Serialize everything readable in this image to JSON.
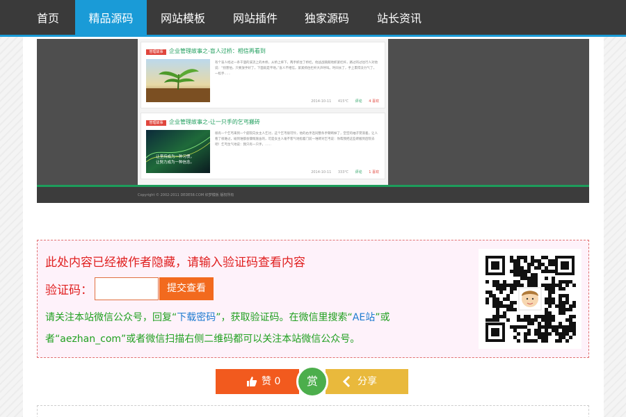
{
  "nav": {
    "items": [
      {
        "label": "首页"
      },
      {
        "label": "精品源码",
        "active": true
      },
      {
        "label": "网站模板"
      },
      {
        "label": "网站插件"
      },
      {
        "label": "独家源码"
      },
      {
        "label": "站长资讯"
      }
    ]
  },
  "screenshot": {
    "articles": [
      {
        "badge": "管理故事",
        "title": "企业管理故事之-盲人过桥：相信再看到",
        "excerpt": "有个盲人经过一条干涸的溪流上的木桥，从桥上摔下，两手抓住了桥栏。他战战兢兢地抓紧栏杆，路过的过往行人对他说：“别害怕，只要放手好了，下面就是平地。”盲人不相信，紧紧抓住栏杆大声呼叫。时间长了，手上累得没力气了，一松手……",
        "date": "2014-10-11",
        "views": "415℃",
        "comments": "评论",
        "likes": "4 喜欢"
      },
      {
        "badge": "管理故事",
        "title": "企业管理故事之-让一只手的乞丐搬砖",
        "excerpt": "很有一个乞丐来到一个庭院向女主人乞讨，这个乞丐很可怜，他的右手连同整条手臂断掉了，空空的袖子晃荡着，让人看了很难过，碰到谁都会慷慨施舍的，可是女主人毫不客气地指着门前一堆砖对乞丐说：你帮我把这些砖搬到后院去吧！乞丐生气地说：我只有一只手，……",
        "date": "2014-10-11",
        "views": "333℃",
        "comments": "评论",
        "likes": "1 喜欢",
        "thumb_text": [
          "让坚持成为一种习惯，",
          "让努力成为一种信念。"
        ]
      }
    ],
    "footer": "Copyright © 2002-2011 DEDE58.COM 织梦模板 版权所有"
  },
  "hidden_box": {
    "title": "此处内容已经被作者隐藏，请输入验证码查看内容",
    "code_label": "验证码：",
    "input_value": "",
    "submit_label": "提交查看",
    "note_part1": "请关注本站微信公众号，回复“",
    "note_keyword": "下载密码",
    "note_part2": "”，获取验证码。在微信里搜索“",
    "note_ae": "AE站",
    "note_part3": "”或者“aezhan_com”或者微信扫描右侧二维码都可以关注本站微信公众号。"
  },
  "actions": {
    "like_label": "赞 0",
    "reward_label": "赏",
    "share_label": "分享"
  },
  "colors": {
    "nav_bg": "#3a3a3a",
    "nav_active": "#1a9bd7",
    "alert_red": "#e02020",
    "note_green": "#20a020",
    "like_orange": "#f25a1e",
    "share_yellow": "#e9b93c",
    "reward_green": "#4cae4c"
  }
}
